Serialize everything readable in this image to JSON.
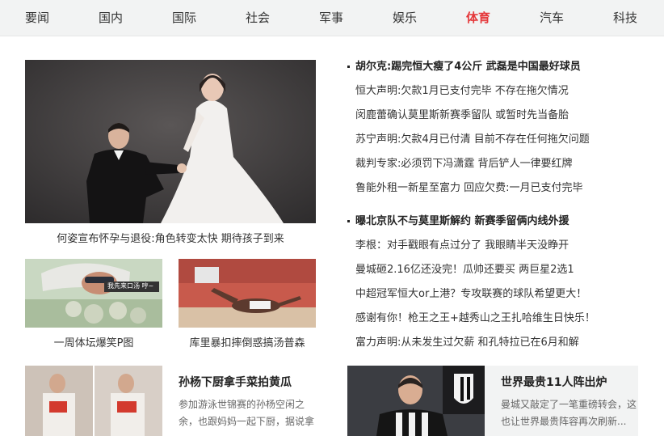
{
  "nav": {
    "items": [
      "要闻",
      "国内",
      "国际",
      "社会",
      "军事",
      "娱乐",
      "体育",
      "汽车",
      "科技"
    ],
    "active": "体育"
  },
  "main_photo": {
    "caption": "何姿宣布怀孕与退役:角色转变太快 期待孩子到来"
  },
  "photo_small_1": {
    "caption": "一周体坛爆笑P图",
    "overlay_text": "我先来口汤 哼~"
  },
  "photo_small_2": {
    "caption": "库里暴扣摔倒惑搞汤普森"
  },
  "news_group_1": [
    "胡尔克:踢完恒大瘦了4公斤 武磊是中国最好球员",
    "恒大声明:欠款1月已支付完毕 不存在拖欠情况",
    "闵鹿蕾确认莫里斯新赛季留队 或暂时先当备胎",
    "苏宁声明:欠款4月已付清 目前不存在任何拖欠问题",
    "裁判专家:必须罚下冯潇霆 背后铲人一律要红牌",
    "鲁能外租一新星至富力 回应欠费:一月已支付完毕"
  ],
  "news_group_2": [
    "曝北京队不与莫里斯解约 新赛季留俩内线外援",
    "李根：对手戳眼有点过分了 我眼睛半天没睁开",
    "曼城砸2.16亿还没完！瓜帅还要买 两巨星2选1",
    "中超冠军恒大or上港？专攻联赛的球队希望更大！",
    "感谢有你！枪王之王+越秀山之王扎哈维生日快乐！",
    "富力声明:从未发生过欠薪 和孔特拉已在6月和解"
  ],
  "card_left": {
    "title": "孙杨下厨拿手菜拍黄瓜",
    "desc": "参加游泳世锦赛的孙杨空闲之余，也跟妈妈一起下厨，据说拿"
  },
  "card_right": {
    "title": "世界最贵11人阵出炉",
    "desc": "曼城又敲定了一笔重磅转会，这也让世界最贵阵容再次刷新..."
  }
}
